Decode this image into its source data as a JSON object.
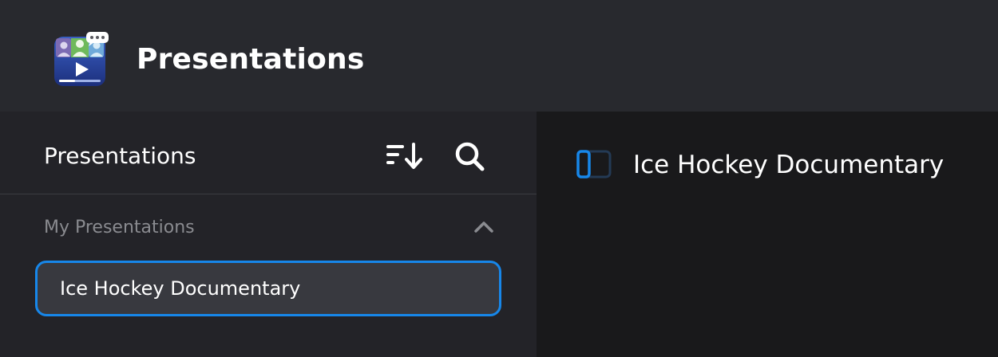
{
  "header": {
    "app_title": "Presentations",
    "app_icon": "presentation-app-icon"
  },
  "sidebar": {
    "title": "Presentations",
    "sort_icon": "sort-descending-icon",
    "search_icon": "search-icon",
    "section": {
      "label": "My Presentations",
      "collapse_icon": "chevron-up-icon",
      "expanded": true
    },
    "items": [
      {
        "label": "Ice Hockey Documentary",
        "selected": true
      }
    ]
  },
  "main": {
    "toggle_icon": "sidebar-toggle-icon",
    "title": "Ice Hockey Documentary"
  },
  "colors": {
    "accent": "#1787ea",
    "header_bg": "#28292e",
    "sidebar_bg": "#232328",
    "main_bg": "#19191b",
    "selected_item_bg": "#38393f",
    "muted_text": "#8a8b90"
  }
}
